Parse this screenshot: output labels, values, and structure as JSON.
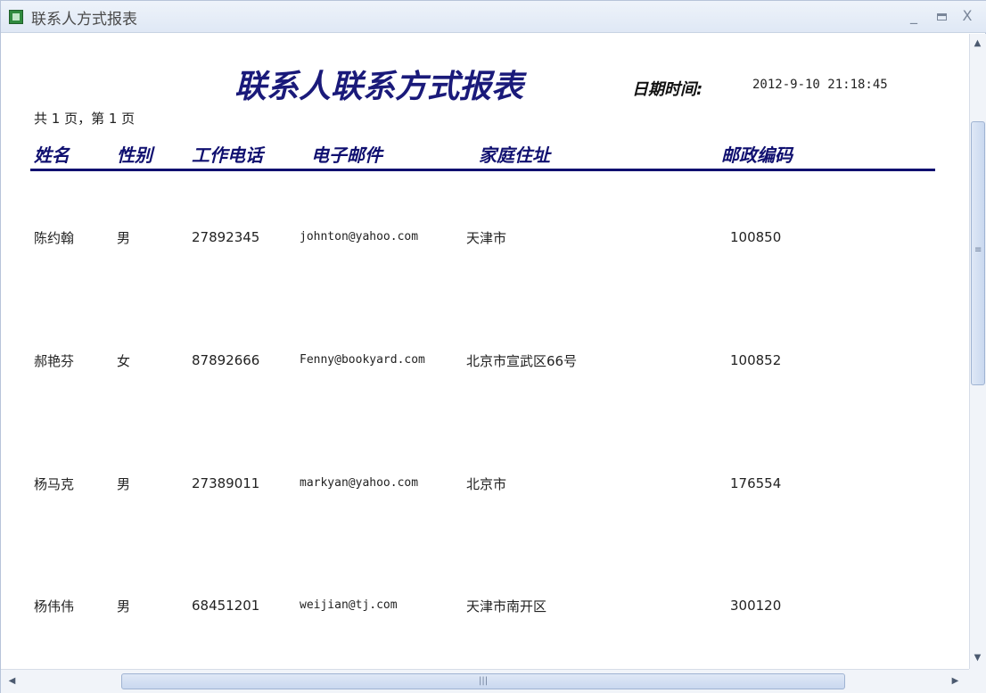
{
  "window": {
    "title": "联系人方式报表",
    "minimize_glyph": "_",
    "close_glyph": "X"
  },
  "report": {
    "title": "联系人联系方式报表",
    "datetime_label": "日期时间:",
    "datetime_value": "2012-9-10 21:18:45",
    "page_info": "共 1 页，第 1 页",
    "columns": [
      "姓名",
      "性别",
      "工作电话",
      "电子邮件",
      "家庭住址",
      "邮政编码"
    ],
    "rows": [
      {
        "name": "陈约翰",
        "gender": "男",
        "phone": "27892345",
        "email": "johnton@yahoo.com",
        "address": "天津市",
        "zip": "100850"
      },
      {
        "name": "郝艳芬",
        "gender": "女",
        "phone": "87892666",
        "email": "Fenny@bookyard.com",
        "address": "北京市宣武区66号",
        "zip": "100852"
      },
      {
        "name": "杨马克",
        "gender": "男",
        "phone": "27389011",
        "email": "markyan@yahoo.com",
        "address": "北京市",
        "zip": "176554"
      },
      {
        "name": "杨伟伟",
        "gender": "男",
        "phone": "68451201",
        "email": "weijian@tj.com",
        "address": "天津市南开区",
        "zip": "300120"
      }
    ]
  },
  "icons": {
    "app": "report-app-icon",
    "scroll_up": "arrow-up-icon",
    "scroll_down": "arrow-down-icon",
    "scroll_left": "arrow-left-icon",
    "scroll_right": "arrow-right-icon"
  },
  "colors": {
    "title_blue": "#1a1a7a",
    "header_blue": "#101070"
  }
}
